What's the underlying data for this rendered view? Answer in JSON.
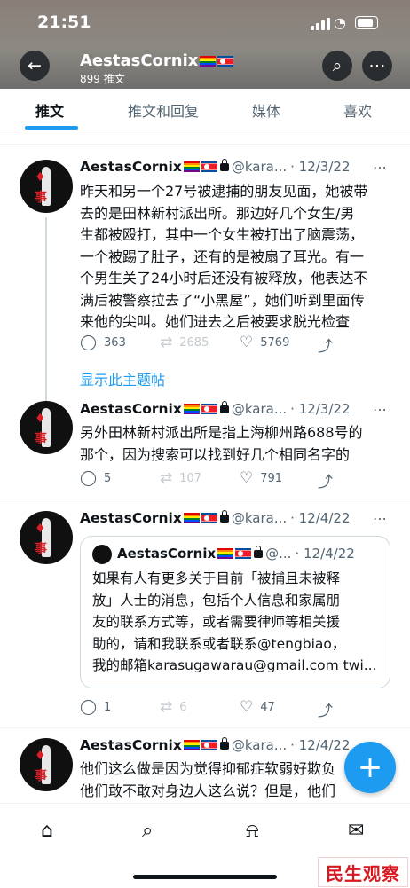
{
  "status_bar": {
    "time": "21:51"
  },
  "header": {
    "name": "AestasCornix",
    "subtitle": "899 推文",
    "back_icon": "arrow-left-icon",
    "search_icon": "search-icon",
    "more_icon": "more-icon"
  },
  "tabs": [
    "推文",
    "推文和回复",
    "媒体",
    "喜欢"
  ],
  "active_tab": 0,
  "tweets": [
    {
      "name": "AestasCornix",
      "handle": "@kara...",
      "date": "· 12/3/22",
      "lines": [
        "昨天和另一个27号被逮捕的朋友见面，她被带",
        "去的是田林新村派出所。那边好几个女生/男",
        "生都被殴打，其中一个女生被打出了脑震荡，",
        "一个被踢了肚子，还有的是被扇了耳光。有一",
        "个男生关了24小时后还没有被释放，他表达不",
        "满后被警察拉去了“小黑屋”，她们听到里面传",
        "来他的尖叫。她们进去之后被要求脱光检查"
      ],
      "replies": "363",
      "retweets": "2685",
      "likes": "5769"
    },
    {
      "name": "AestasCornix",
      "handle": "@kara...",
      "date": "· 12/3/22",
      "lines": [
        "另外田林新村派出所是指上海柳州路688号的",
        "那个，因为搜索可以找到好几个相同名字的"
      ],
      "replies": "5",
      "retweets": "107",
      "likes": "791"
    },
    {
      "name": "AestasCornix",
      "handle": "@kara...",
      "date": "· 12/4/22",
      "quote": {
        "name": "AestasCornix",
        "handle": "@...",
        "date": "· 12/4/22",
        "lines": [
          "如果有人有更多关于目前「被捕且未被释",
          "放」人士的消息，包括个人信息和家属朋",
          "友的联系方式等，或者需要律师等相关援",
          "助的，请和我联系或者联系@tengbiao，",
          "我的邮箱karasugawarau@gmail.com twi..."
        ]
      },
      "replies": "1",
      "retweets": "6",
      "likes": "47"
    },
    {
      "name": "AestasCornix",
      "handle": "@kara...",
      "date": "· 12/4/22",
      "lines": [
        "他们这么做是因为觉得抑郁症软弱好欺负",
        "他们敢不敢对身边人这么说？但是，他们"
      ]
    }
  ],
  "show_thread": "显示此主题帖",
  "avatar_text": [
    "事"
  ],
  "bottom_nav": [
    "home-icon",
    "search-icon",
    "bell-icon",
    "mail-icon"
  ],
  "watermark": "民生观察",
  "colors": {
    "accent": "#1d9bf0",
    "text": "#0f1419",
    "muted": "#536471",
    "watermark": "#d71920"
  }
}
